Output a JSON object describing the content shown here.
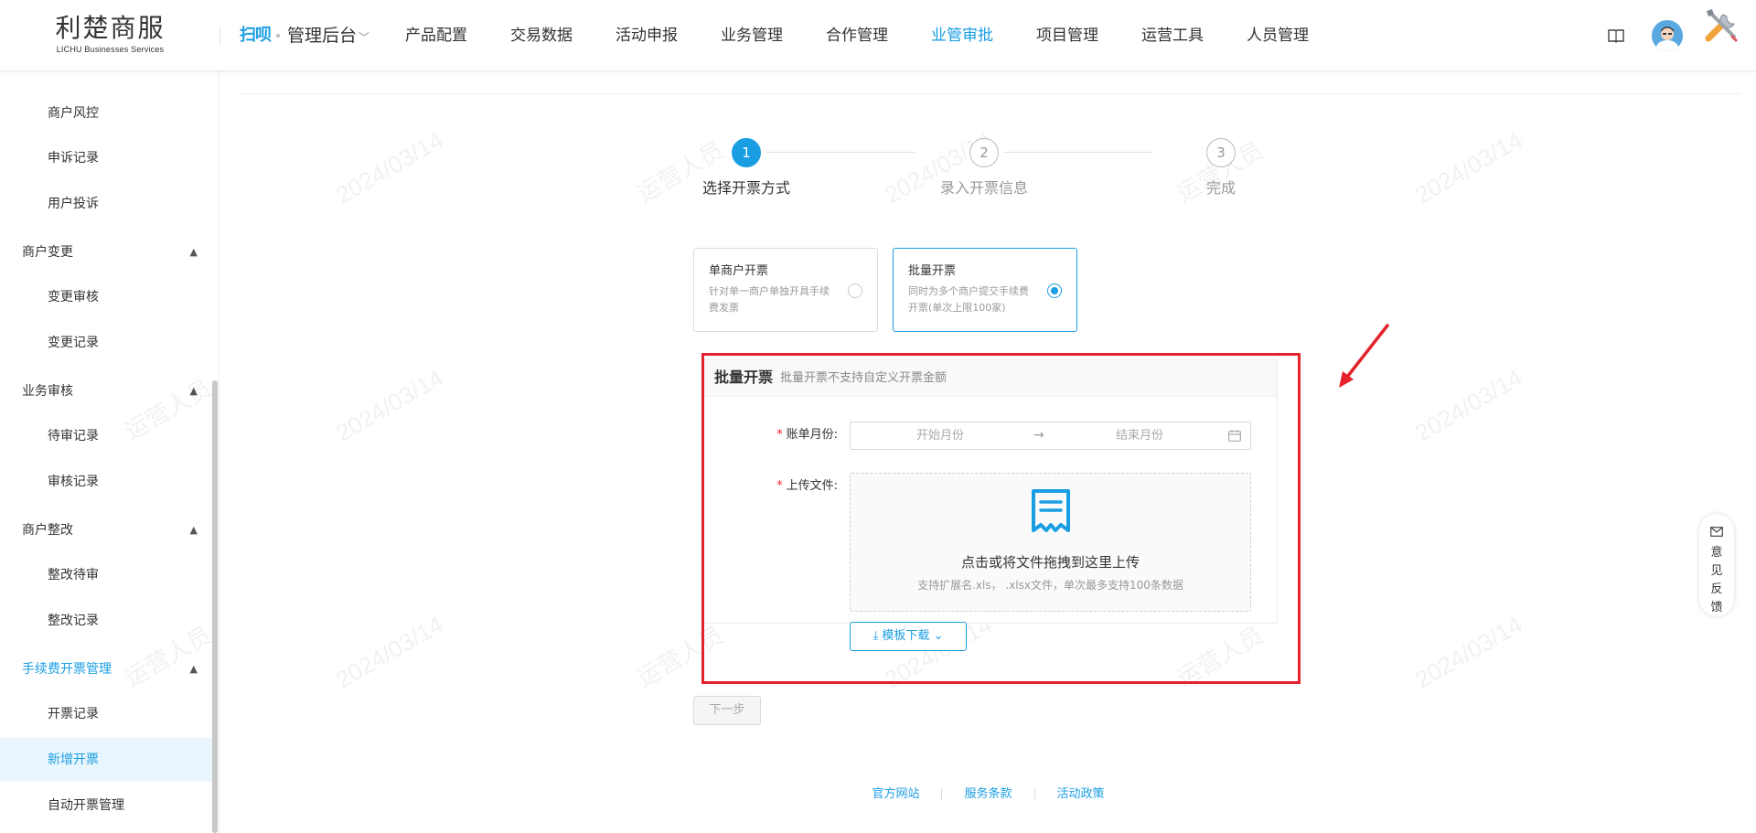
{
  "header": {
    "logo_cn": "利楚商服",
    "logo_en": "LICHU Businesses Services",
    "brand_mark": "扫呗",
    "admin_switch": "管理后台",
    "nav": [
      "产品配置",
      "交易数据",
      "活动申报",
      "业务管理",
      "合作管理",
      "业管审批",
      "项目管理",
      "运营工具",
      "人员管理"
    ],
    "nav_active": "业管审批"
  },
  "sidebar": {
    "items": [
      {
        "label": "商户风控",
        "type": "item"
      },
      {
        "label": "申诉记录",
        "type": "item"
      },
      {
        "label": "用户投诉",
        "type": "item"
      },
      {
        "label": "商户变更",
        "type": "group"
      },
      {
        "label": "变更审核",
        "type": "item"
      },
      {
        "label": "变更记录",
        "type": "item"
      },
      {
        "label": "业务审核",
        "type": "group"
      },
      {
        "label": "待审记录",
        "type": "item"
      },
      {
        "label": "审核记录",
        "type": "item"
      },
      {
        "label": "商户整改",
        "type": "group"
      },
      {
        "label": "整改待审",
        "type": "item"
      },
      {
        "label": "整改记录",
        "type": "item"
      },
      {
        "label": "手续费开票管理",
        "type": "group"
      },
      {
        "label": "开票记录",
        "type": "item"
      },
      {
        "label": "新增开票",
        "type": "item"
      },
      {
        "label": "自动开票管理",
        "type": "item"
      }
    ]
  },
  "steps": [
    {
      "num": "1",
      "label": "选择开票方式",
      "active": true
    },
    {
      "num": "2",
      "label": "录入开票信息",
      "active": false
    },
    {
      "num": "3",
      "label": "完成",
      "active": false
    }
  ],
  "options": {
    "single": {
      "title": "单商户开票",
      "desc": "针对单一商户单独开具手续费发票"
    },
    "batch": {
      "title": "批量开票",
      "desc": "同时为多个商户提交手续费开票(单次上限100家)"
    }
  },
  "panel": {
    "title": "批量开票",
    "subtitle": "批量开票不支持自定义开票金额",
    "bill_month_label": "账单月份:",
    "start_placeholder": "开始月份",
    "range_sep": "→",
    "end_placeholder": "结束月份",
    "upload_label": "上传文件:",
    "upload_main": "点击或将文件拖拽到这里上传",
    "upload_tip": "支持扩展名.xls， .xlsx文件，单次最多支持100条数据",
    "template_button": "模板下载"
  },
  "next_button": "下一步",
  "footer": [
    "官方网站",
    "服务条款",
    "活动政策"
  ],
  "feedback": "意见反馈",
  "watermark": {
    "name": "运营人员",
    "date": "2024/03/14"
  },
  "colors": {
    "accent": "#1a9ee3",
    "annotation": "#e3222b",
    "required": "#f5222d"
  }
}
